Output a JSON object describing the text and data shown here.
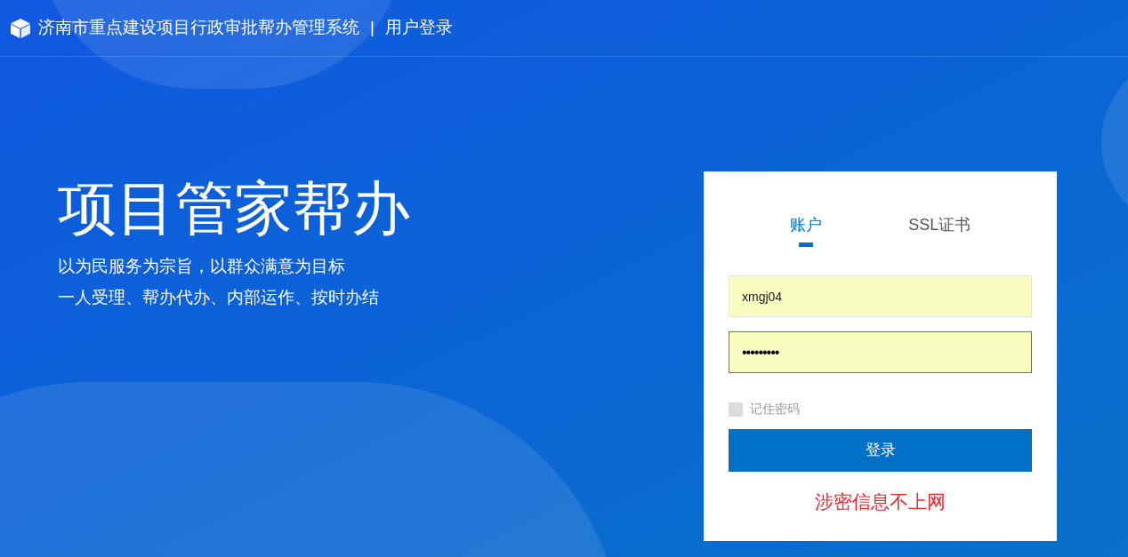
{
  "header": {
    "system_name": "济南市重点建设项目行政审批帮办管理系统",
    "separator": "|",
    "page_title": "用户登录"
  },
  "hero": {
    "title": "项目管家帮办",
    "lines": [
      "以为民服务为宗旨，以群众满意为目标",
      "一人受理、帮办代办、内部运作、按时办结"
    ]
  },
  "login": {
    "tabs": [
      {
        "label": "账户",
        "selected": true
      },
      {
        "label": "SSL证书",
        "selected": false
      }
    ],
    "fields": [
      {
        "kind": "text",
        "value": "xmgj04",
        "focused": false
      },
      {
        "kind": "password",
        "value": "•••••••••",
        "focused": true
      }
    ],
    "remember": {
      "label": "记住密码",
      "checked": false
    },
    "submit": "登录",
    "notice": "涉密信息不上网"
  }
}
